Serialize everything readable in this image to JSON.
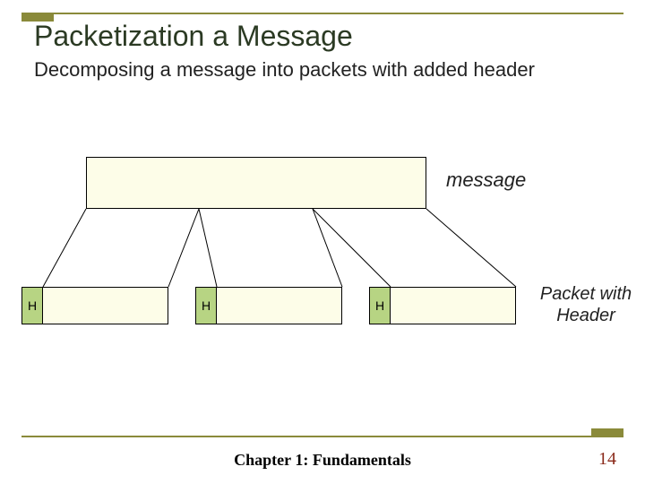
{
  "title": "Packetization a Message",
  "subtitle": "Decomposing a message into packets with added header",
  "labels": {
    "message": "message",
    "packet_with_header_line1": "Packet with",
    "packet_with_header_line2": "Header"
  },
  "packets": {
    "h": "H"
  },
  "footer": {
    "chapter": "Chapter 1: Fundamentals",
    "page": "14"
  }
}
